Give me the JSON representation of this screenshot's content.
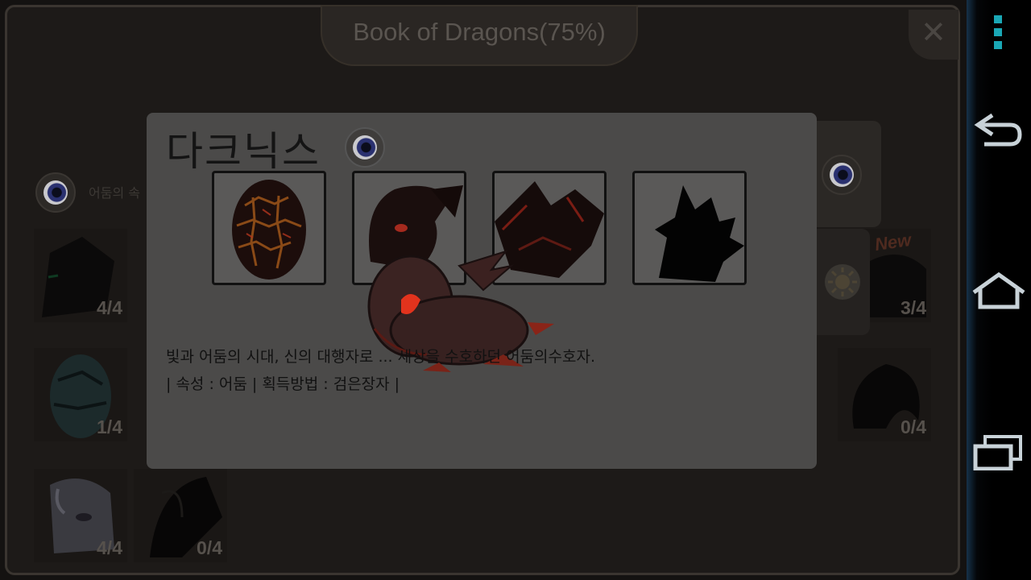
{
  "window": {
    "title": "Book of Dragons(75%)",
    "close_glyph": "✕"
  },
  "section": {
    "label": "어둠의 속",
    "element_icon": "dark-element-icon"
  },
  "cards": [
    {
      "count": "4/4"
    },
    {
      "count": "3/4"
    },
    {
      "count": "1/4"
    },
    {
      "count": "0/4"
    },
    {
      "count": "4/4"
    },
    {
      "count": "0/4"
    }
  ],
  "badge": {
    "new": "New"
  },
  "popup": {
    "name": "다크닉스",
    "element_icon": "dark-element-icon",
    "stages": [
      "egg",
      "baby",
      "teen",
      "adult-silhouette"
    ],
    "description_line1": "빛과 어둠의 시대, 신의 대행자로 ... 세상을 수호하던 어둠의수호자.",
    "description_line2": "| 속성 : 어둠 | 획득방법 : 검은장자 |"
  },
  "colors": {
    "overlay_dark": "#141211",
    "popup_bg": "#4b4a49",
    "lava": "#c0392b",
    "nav_accent": "#1aa7b5"
  },
  "navbar": {
    "menu_icon": "overflow-menu-icon",
    "back_icon": "back-icon",
    "home_icon": "home-icon",
    "recents_icon": "recents-icon"
  }
}
